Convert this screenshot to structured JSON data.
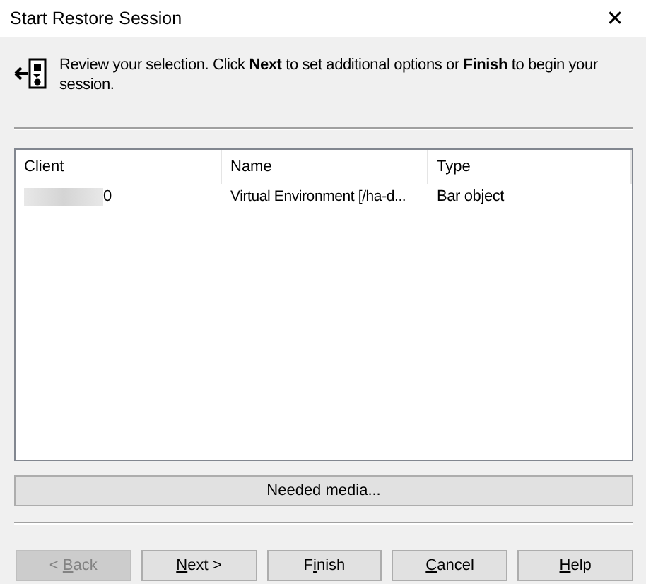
{
  "window": {
    "title": "Start Restore Session",
    "close": "✕"
  },
  "header": {
    "text": "Review your selection. Click **Next** to set additional options or **Finish** to begin your session."
  },
  "table": {
    "columns": [
      "Client",
      "Name",
      "Type"
    ],
    "rows": [
      {
        "client": "0",
        "client_redacted": true,
        "name": "Virtual Environment [/ha-d...",
        "type": "Bar object"
      }
    ]
  },
  "media_button": "Needed media...",
  "buttons": [
    {
      "before": "< ",
      "key": "B",
      "after": "ack",
      "disabled": true
    },
    {
      "key": "N",
      "after": "ext >",
      "disabled": false
    },
    {
      "before": "F",
      "key": "i",
      "after": "nish",
      "disabled": false
    },
    {
      "key": "C",
      "after": "ancel",
      "disabled": false
    },
    {
      "key": "H",
      "after": "elp",
      "disabled": false
    }
  ]
}
